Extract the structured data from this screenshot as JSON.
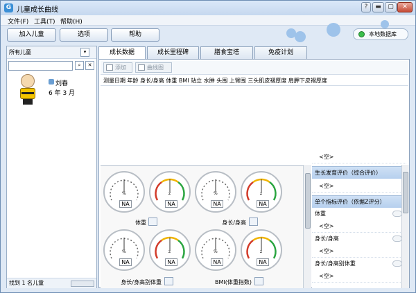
{
  "window": {
    "title": "儿童成长曲线",
    "buttons": {
      "help": "?",
      "minimize": "▬",
      "maximize": "▢",
      "close": "✕"
    }
  },
  "menu": [
    "文件(F)",
    "工具(T)",
    "帮助(H)"
  ],
  "toolbar": {
    "add_child": "加入儿童",
    "options": "选项",
    "help": "帮助",
    "db_status": "本地数据库"
  },
  "left": {
    "header": "所有儿童",
    "child": {
      "name": "刘春",
      "age": "6 年 3 月"
    },
    "footer": "找到 1 名儿童"
  },
  "tabs": [
    "成长数据",
    "成长里程碑",
    "膳食宝塔",
    "免疫计划"
  ],
  "subtoolbar": {
    "add": "添加",
    "chart": "曲线图"
  },
  "columns": "测量日期 年龄 身长/身高 体重 BMI 站立 水肿 头围 上臂围 三头肌皮褶厚度 肩胛下皮褶厚度",
  "gauges": [
    {
      "unit": "%",
      "value": "NA"
    },
    {
      "unit": "z",
      "value": "NA"
    },
    {
      "unit": "%",
      "value": "NA"
    },
    {
      "unit": "z",
      "value": "NA"
    },
    {
      "unit": "%",
      "value": "NA"
    },
    {
      "unit": "z",
      "value": "NA"
    },
    {
      "unit": "%",
      "value": "NA"
    },
    {
      "unit": "z",
      "value": "NA"
    }
  ],
  "gauge_labels": [
    "体重",
    "身长/身高",
    "身长/身高别体重",
    "BMI(体重指数)"
  ],
  "evaluation": {
    "top_empty": "<空>",
    "overall_header": "生长发育评价（综合评价）",
    "overall_value": "<空>",
    "single_header": "单个指标评价（依据Z评分）",
    "items": [
      {
        "label": "体重",
        "value": "<空>"
      },
      {
        "label": "身长/身高",
        "value": "<空>"
      },
      {
        "label": "身长/身高别体重",
        "value": "<空>"
      }
    ]
  }
}
